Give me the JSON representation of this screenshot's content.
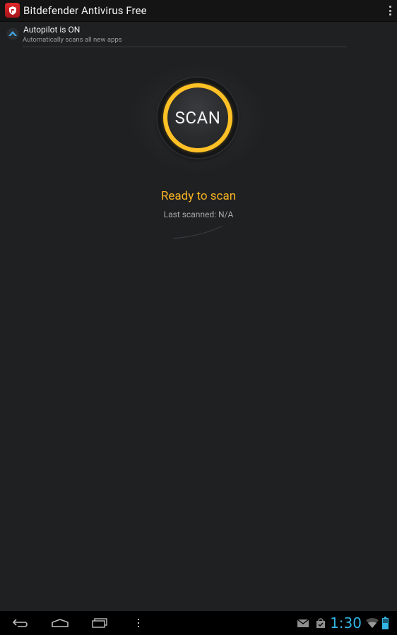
{
  "app": {
    "title": "Bitdefender Antivirus Free",
    "icon": "bitdefender-logo-icon",
    "menu_icon": "overflow-menu-icon"
  },
  "autopilot": {
    "title": "Autopilot is ON",
    "subtitle": "Automatically scans all new apps",
    "icon": "autopilot-icon"
  },
  "scan": {
    "button_label": "SCAN",
    "status": "Ready to scan",
    "last_scanned": "Last scanned: N/A"
  },
  "system_bar": {
    "time": "1:30",
    "nav_icons": [
      "back-icon",
      "home-icon",
      "recent-apps-icon",
      "menu-icon"
    ],
    "status_icons": [
      "gmail-icon",
      "store-bag-icon",
      "wifi-icon",
      "battery-icon"
    ]
  },
  "colors": {
    "background": "#1f2022",
    "accent": "#f6b321",
    "ring": "#ffc125",
    "clock": "#33b5e5",
    "brand_red": "#d8222a"
  }
}
